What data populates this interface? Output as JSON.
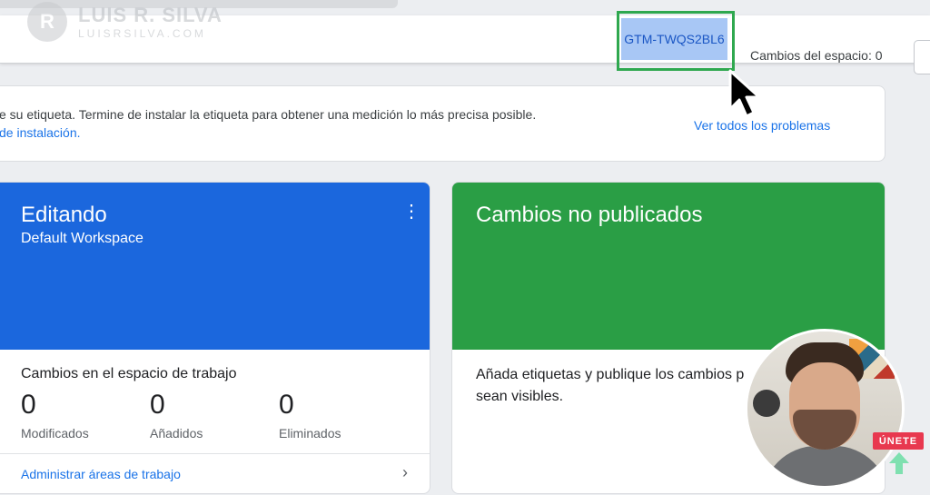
{
  "watermark": {
    "name": "LUIS R. SILVA",
    "url": "LUISRSILVA.COM",
    "logo_text": "R"
  },
  "header": {
    "container_id": "GTM-TWQS2BL6",
    "changes_label": "Cambios del espacio: 0"
  },
  "notice": {
    "text": "e su etiqueta. Termine de instalar la etiqueta para obtener una medición lo más precisa posible.",
    "link": "de instalación.",
    "view_all": "Ver todos los problemas"
  },
  "editing_card": {
    "title": "Editando",
    "subtitle": "Default Workspace",
    "menu_icon": "more-vert-icon",
    "section_label": "Cambios en el espacio de trabajo",
    "stats": [
      {
        "value": "0",
        "label": "Modificados"
      },
      {
        "value": "0",
        "label": "Añadidos"
      },
      {
        "value": "0",
        "label": "Eliminados"
      }
    ],
    "manage_link": "Administrar áreas de trabajo",
    "color": "#1b67dd"
  },
  "unpublished_card": {
    "title": "Cambios no publicados",
    "body": "Añada etiquetas y publique los cambios p sean visibles.",
    "color": "#2a9e45"
  },
  "overlay": {
    "join_label": "ÚNETE"
  },
  "colors": {
    "highlight": "#2fa84f",
    "link": "#1a73e8",
    "selection": "#a8c7f5"
  }
}
